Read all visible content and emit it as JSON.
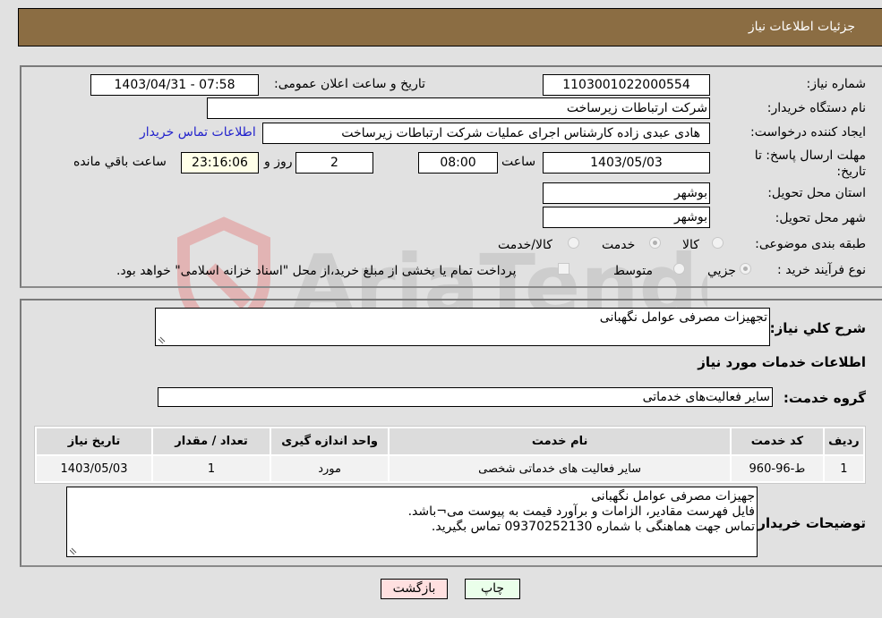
{
  "header": {
    "title": "جزئیات اطلاعات نیاز"
  },
  "form": {
    "need_number": {
      "label": "شماره نیاز:",
      "value": "1103001022000554"
    },
    "announce_datetime": {
      "label": "تاریخ و ساعت اعلان عمومی:",
      "value": "1403/04/31 - 07:58"
    },
    "buyer_org": {
      "label": "نام دستگاه خریدار:",
      "value": "شرکت ارتباطات زیرساخت"
    },
    "requester": {
      "label": "ایجاد کننده درخواست:",
      "value": "هادی عبدی زاده کارشناس اجرای عملیات شرکت ارتباطات زیرساخت"
    },
    "buyer_contact_link": "اطلاعات تماس خریدار",
    "deadline": {
      "label": "مهلت ارسال پاسخ: تا تاریخ:",
      "date": "1403/05/03",
      "time_label": "ساعت",
      "time": "08:00",
      "days": "2",
      "days_label": "روز و",
      "remaining": "23:16:06",
      "remaining_label": "ساعت باقي مانده"
    },
    "delivery_province": {
      "label": "استان محل تحویل:",
      "value": "بوشهر"
    },
    "delivery_city": {
      "label": "شهر محل تحویل:",
      "value": "بوشهر"
    },
    "category": {
      "label": "طبقه بندی موضوعی:",
      "options": [
        "کالا",
        "خدمت",
        "کالا/خدمت"
      ],
      "selected": "خدمت"
    },
    "purchase_type": {
      "label": "نوع فرآیند خرید :",
      "options": [
        "جزیي",
        "متوسط"
      ],
      "selected": "جزیي",
      "treasury_note": "پرداخت تمام یا بخشی از مبلغ خرید،از محل \"اسناد خزانه اسلامی\" خواهد بود.",
      "treasury_checked": false
    }
  },
  "summary": {
    "label": "شرح کلي نیاز:",
    "value": "تجهیزات مصرفی عوامل نگهبانی"
  },
  "services_section": {
    "title": "اطلاعات خدمات مورد نیاز",
    "group_label": "گروه خدمت:",
    "group_value": "سایر فعالیت‌های خدماتی",
    "table": {
      "headers": [
        "ردیف",
        "کد خدمت",
        "نام خدمت",
        "واحد اندازه گیری",
        "تعداد / مقدار",
        "تاریخ نیاز"
      ],
      "rows": [
        [
          "1",
          "ط-96-960",
          "سایر فعالیت های خدماتی شخصی",
          "مورد",
          "1",
          "1403/05/03"
        ]
      ]
    }
  },
  "buyer_notes": {
    "label": "توضیحات خریدار:",
    "lines": [
      "جهیزات مصرفی عوامل نگهبانی",
      "فایل فهرست مقادیر، الزامات و برآورد قیمت به پیوست می¬باشد.",
      "تماس جهت هماهنگی با شماره 09370252130 تماس بگیرید."
    ]
  },
  "buttons": {
    "print": "چاپ",
    "back": "بازگشت"
  },
  "colors": {
    "header_bg": "#8b6d43",
    "print_bg": "#eaffea",
    "back_bg": "#ffe0e0",
    "link": "#2222cc"
  },
  "watermark": "AriaTender.neT"
}
